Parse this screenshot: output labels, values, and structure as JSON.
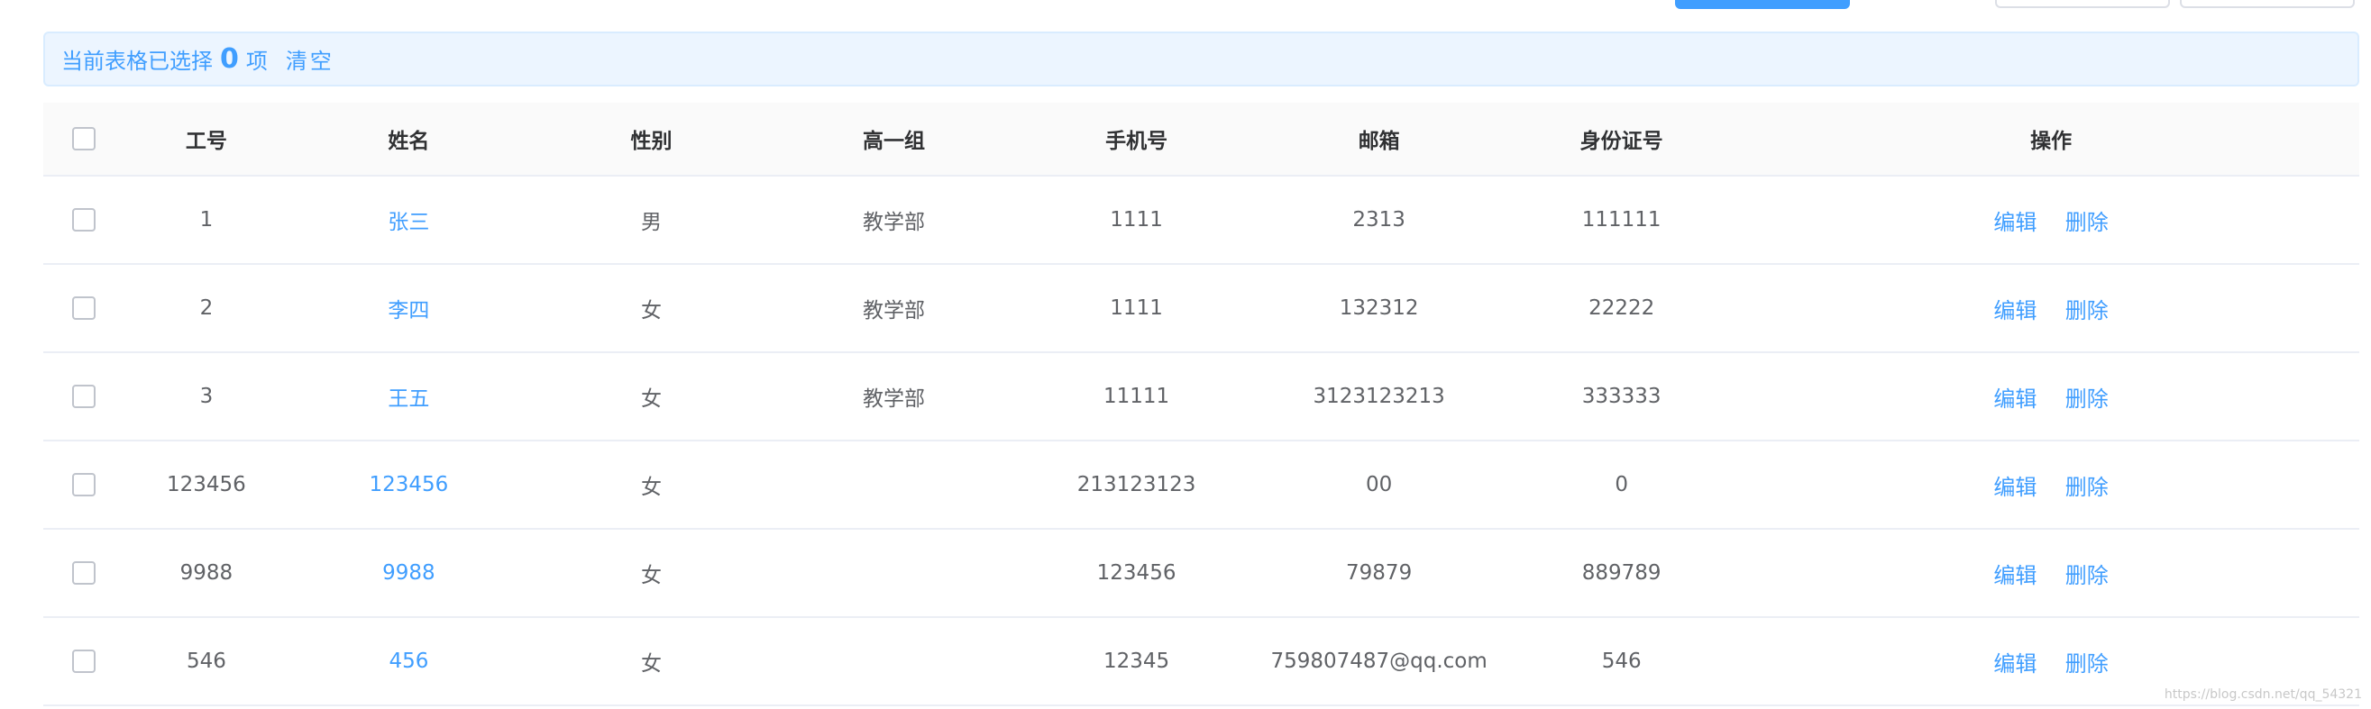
{
  "selection_bar": {
    "prefix": "当前表格已选择",
    "count": "0",
    "suffix": "项",
    "clear_label": "清空"
  },
  "table": {
    "headers": {
      "id": "工号",
      "name": "姓名",
      "gender": "性别",
      "dept": "高一组",
      "phone": "手机号",
      "email": "邮箱",
      "idcard": "身份证号",
      "action": "操作"
    },
    "rows": [
      {
        "id": "1",
        "name": "张三",
        "gender": "男",
        "dept": "教学部",
        "phone": "1111",
        "email": "2313",
        "idcard": "111111"
      },
      {
        "id": "2",
        "name": "李四",
        "gender": "女",
        "dept": "教学部",
        "phone": "1111",
        "email": "132312",
        "idcard": "22222"
      },
      {
        "id": "3",
        "name": "王五",
        "gender": "女",
        "dept": "教学部",
        "phone": "11111",
        "email": "3123123213",
        "idcard": "333333"
      },
      {
        "id": "123456",
        "name": "123456",
        "gender": "女",
        "dept": "",
        "phone": "213123123",
        "email": "00",
        "idcard": "0"
      },
      {
        "id": "9988",
        "name": "9988",
        "gender": "女",
        "dept": "",
        "phone": "123456",
        "email": "79879",
        "idcard": "889789"
      },
      {
        "id": "546",
        "name": "456",
        "gender": "女",
        "dept": "",
        "phone": "12345",
        "email": "759807487@qq.com",
        "idcard": "546"
      }
    ],
    "edit_label": "编辑",
    "delete_label": "删除"
  },
  "watermark": "https://blog.csdn.net/qq_54321"
}
